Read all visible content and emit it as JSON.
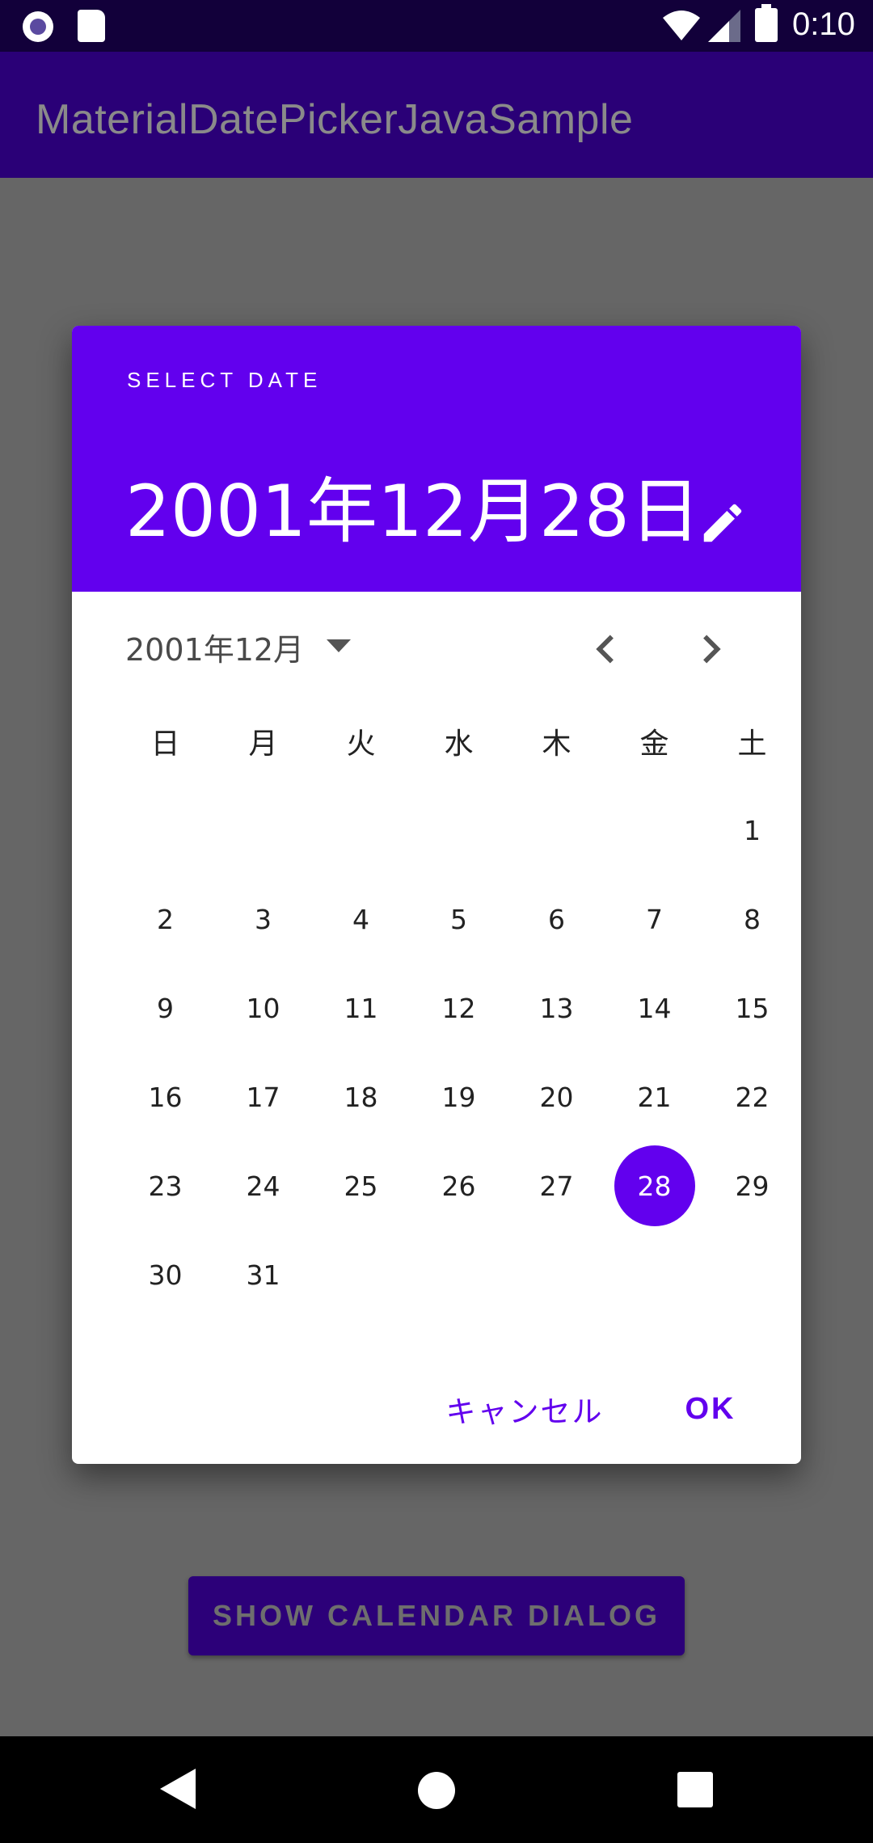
{
  "status_bar": {
    "time": "0:10"
  },
  "app": {
    "title": "MaterialDatePickerJavaSample",
    "show_button_label": "SHOW CALENDAR DIALOG"
  },
  "dialog": {
    "overline": "SELECT DATE",
    "selected_date": "2001年12月28日",
    "month_label": "2001年12月",
    "weekdays": [
      "日",
      "月",
      "火",
      "水",
      "木",
      "金",
      "土"
    ],
    "weeks": [
      [
        "",
        "",
        "",
        "",
        "",
        "",
        "1"
      ],
      [
        "2",
        "3",
        "4",
        "5",
        "6",
        "7",
        "8"
      ],
      [
        "9",
        "10",
        "11",
        "12",
        "13",
        "14",
        "15"
      ],
      [
        "16",
        "17",
        "18",
        "19",
        "20",
        "21",
        "22"
      ],
      [
        "23",
        "24",
        "25",
        "26",
        "27",
        "28",
        "29"
      ],
      [
        "30",
        "31",
        "",
        "",
        "",
        "",
        ""
      ]
    ],
    "selected_day": "28",
    "cancel_label": "キャンセル",
    "ok_label": "OK"
  },
  "colors": {
    "primary": "#6200ee",
    "app_bar": "#2a0077",
    "scrim_background": "#666666"
  },
  "icons": {
    "edit": "pencil-icon",
    "month_dropdown": "dropdown-arrow-icon",
    "prev": "chevron-left-icon",
    "next": "chevron-right-icon"
  }
}
